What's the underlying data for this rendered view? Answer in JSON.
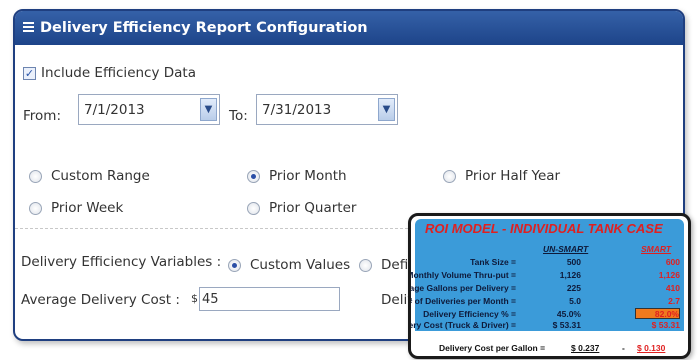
{
  "panel": {
    "title": "Delivery Efficiency Report Configuration",
    "include_label": "Include Efficiency Data",
    "include_checked": true,
    "from_label": "From:",
    "from_value": "7/1/2013",
    "to_label": "To:",
    "to_value": "7/31/2013",
    "ranges": [
      {
        "label": "Custom Range",
        "selected": false
      },
      {
        "label": "Prior Month",
        "selected": true
      },
      {
        "label": "Prior Half Year",
        "selected": false
      },
      {
        "label": "Prior Week",
        "selected": false
      },
      {
        "label": "Prior Quarter",
        "selected": false
      }
    ],
    "variables_label": "Delivery Efficiency Variables :",
    "variables_options": [
      {
        "label": "Custom Values",
        "selected": true
      },
      {
        "label": "Defin",
        "selected": false
      }
    ],
    "avg_cost_label": "Average Delivery Cost :",
    "avg_cost_currency": "$",
    "avg_cost_value": "45",
    "deliv_label_partial": "Deliv"
  },
  "roi": {
    "title": "ROI MODEL - INDIVIDUAL TANK CASE",
    "col1_header": "UN-SMART",
    "col2_header": "SMART",
    "rows": [
      {
        "label": "Tank Size =",
        "unsmart": "500",
        "smart": "600"
      },
      {
        "label": "Monthly Volume Thru-put =",
        "unsmart": "1,126",
        "smart": "1,126"
      },
      {
        "label": "Average Gallons per Delivery =",
        "unsmart": "225",
        "smart": "410"
      },
      {
        "label": "# of Deliveries per Month =",
        "unsmart": "5.0",
        "smart": "2.7"
      },
      {
        "label": "Delivery Efficiency % =",
        "unsmart": "45.0%",
        "smart": "82.0%"
      },
      {
        "label": "Delivery Cost (Truck & Driver) =",
        "unsmart": "$ 53.31",
        "smart": "$ 53.31"
      }
    ],
    "footer_label": "Delivery Cost per Gallon =",
    "footer_unsmart": "$ 0.237",
    "footer_sep": "-",
    "footer_smart": "$ 0.130"
  },
  "colors": {
    "header": "#1d4489",
    "roi_blue": "#3b9bd9",
    "roi_red": "#e02020",
    "highlight": "#f07a1e"
  }
}
